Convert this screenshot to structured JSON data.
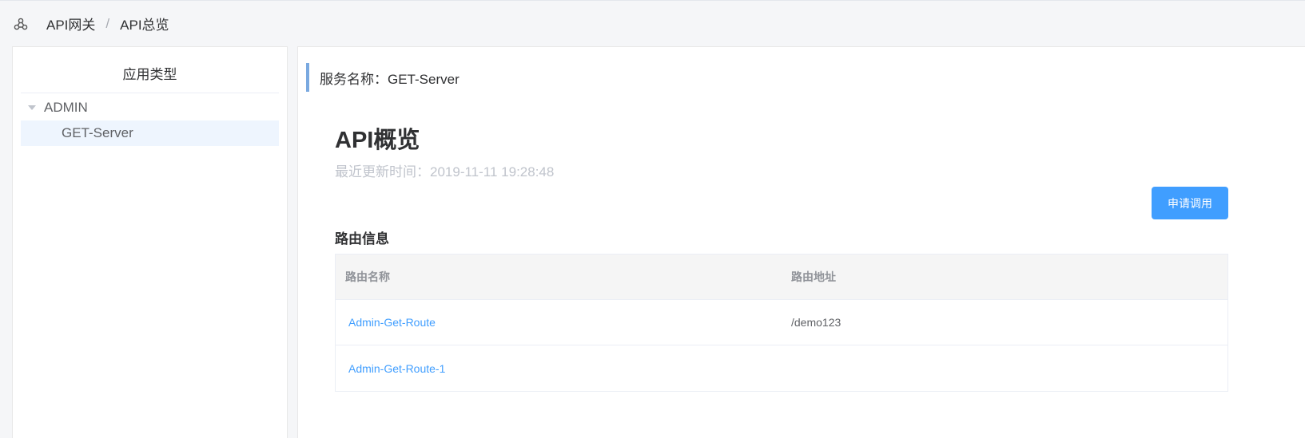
{
  "breadcrumb": {
    "items": [
      "API网关",
      "API总览"
    ],
    "separator": "/"
  },
  "sidebar": {
    "title": "应用类型",
    "tree": [
      {
        "label": "ADMIN",
        "expanded": true,
        "children": [
          {
            "label": "GET-Server",
            "selected": true
          }
        ]
      }
    ]
  },
  "main": {
    "service_title": "服务名称：GET-Server",
    "page_title": "API概览",
    "updated_text": "最近更新时间：2019-11-11 19:28:48",
    "apply_button": "申请调用",
    "section_title": "路由信息",
    "table": {
      "columns": [
        "路由名称",
        "路由地址"
      ],
      "rows": [
        [
          "Admin-Get-Route",
          "/demo123"
        ],
        [
          "Admin-Get-Route-1",
          ""
        ]
      ]
    }
  },
  "colors": {
    "accent": "#409eff",
    "selected_bg": "#eef5fe",
    "service_bar": "#7aa9e0"
  }
}
